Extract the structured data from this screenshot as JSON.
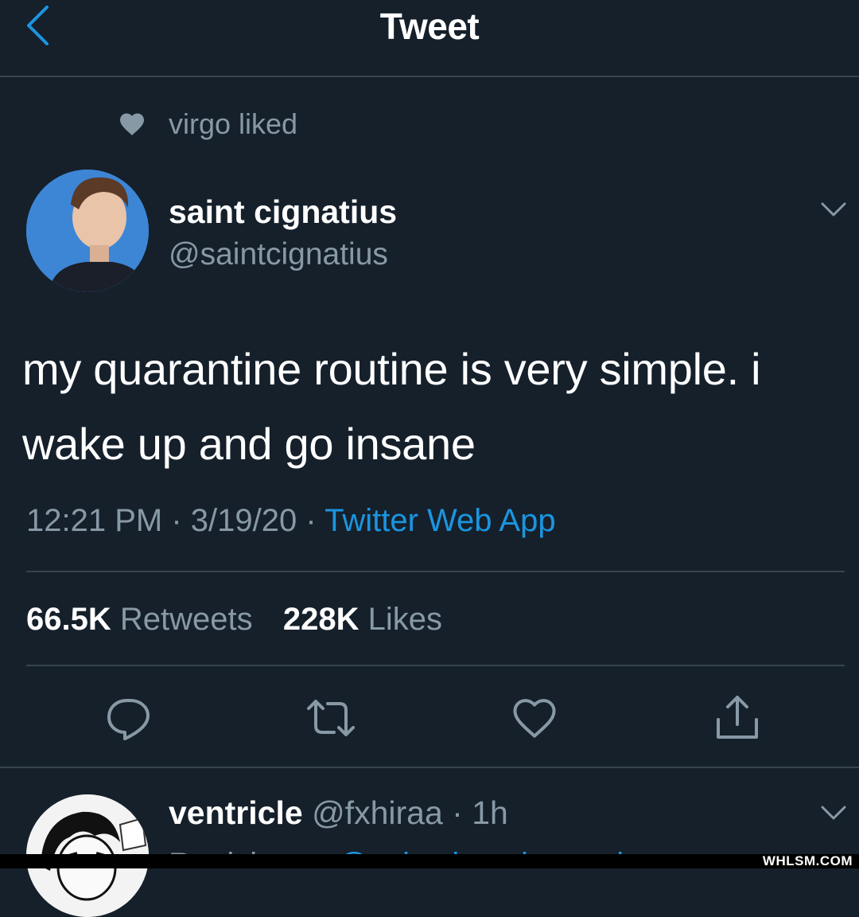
{
  "header": {
    "title": "Tweet"
  },
  "social_context": {
    "text": "virgo liked"
  },
  "tweet": {
    "author_name": "saint cignatius",
    "author_handle": "@saintcignatius",
    "text": "my quarantine routine is very simple. i wake up and go insane",
    "time": "12:21 PM",
    "date": "3/19/20",
    "source": "Twitter Web App",
    "retweets_count": "66.5K",
    "retweets_label": "Retweets",
    "likes_count": "228K",
    "likes_label": "Likes"
  },
  "reply": {
    "author_name": "ventricle",
    "author_handle": "@fxhiraa",
    "time": "1h",
    "peek_prefix": "Replying to",
    "peek_mention": "@saintcignatius and"
  },
  "icons": {
    "back": "chevron-left-icon",
    "liked": "heart-filled-icon",
    "caret": "chevron-down-icon",
    "reply": "comment-icon",
    "retweet": "retweet-icon",
    "like": "heart-outline-icon",
    "share": "share-icon"
  },
  "colors": {
    "background": "#15202b",
    "divider": "#38444d",
    "secondary_text": "#8899a6",
    "accent": "#1b95e0"
  },
  "watermark": "WHLSM.COM"
}
